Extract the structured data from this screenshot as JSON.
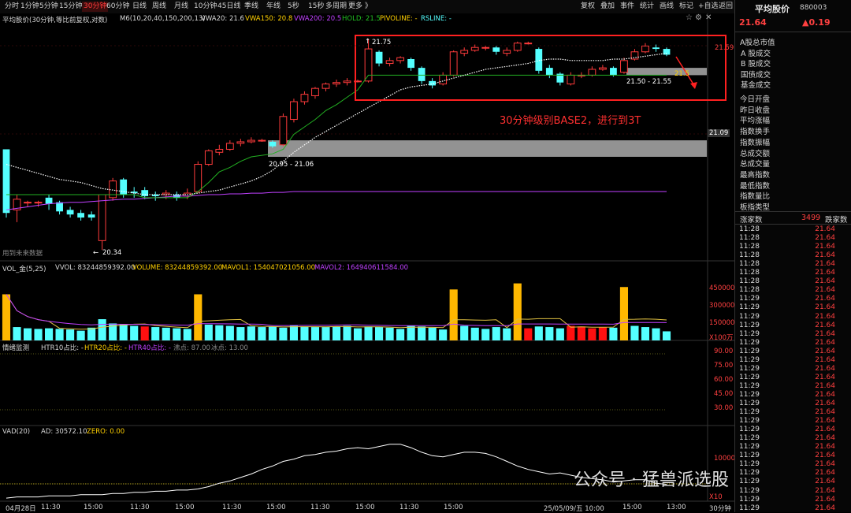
{
  "toolbar": {
    "timeframes": [
      "分时",
      "1分钟",
      "5分钟",
      "15分钟",
      "30分钟",
      "60分钟",
      "日线",
      "周线",
      "月线",
      "10分钟",
      "45日线",
      "季线",
      "年线",
      "5秒",
      "15秒",
      "多周期",
      "更多 》"
    ],
    "active_timeframe": "30分钟",
    "right": [
      "复权",
      "叠加",
      "事件",
      "统计",
      "画线",
      "标记",
      "+自选",
      "返回"
    ],
    "star_icon": "star-icon",
    "settings_icon": "gear-icon",
    "close_icon": "close-icon"
  },
  "chart_header": {
    "name": "平均股价(30分钟,等比前复权,对数)",
    "ma": "M6(10,20,40,150,200,13)",
    "vwa20": "VWA20: 21.6",
    "vwa150": "VWA150: 20.8",
    "vwa200": "VWA200: 20.5",
    "hold": "HOLD: 21.5",
    "pivoline": "PIVOLINE: -",
    "rsline": "RSLINE: -"
  },
  "annotations": {
    "high_label": "21.75",
    "low_label": "20.34",
    "zone1_label": "20.95 - 21.06",
    "zone2_label": "21.50 - 21.55",
    "hold_label": "21.5",
    "note": "30分钟级别BASE2，进行到3T",
    "future_data": "用到未来数据"
  },
  "price_axis": {
    "top": "21.59",
    "mid": "21.09"
  },
  "volume_header": {
    "name": "VOL_金(5,25)",
    "vvol": "VVOL: 83244859392.00",
    "volume": "VOLUME: 83244859392.00",
    "mavol1": "MAVOL1: 154047021056.00",
    "mavol2": "MAVOL2: 164940611584.00"
  },
  "volume_axis": [
    "450000",
    "300000",
    "150000",
    "X100万"
  ],
  "htr_header": {
    "name": "情绪监测",
    "htr10": "HTR10占比: -",
    "htr20": "HTR20占比: -",
    "htr40": "HTR40占比: -",
    "boil": "沸点: 87.00",
    "ice": "冰点: 13.00"
  },
  "htr_axis": [
    "90.00",
    "75.00",
    "60.00",
    "45.00",
    "30.00"
  ],
  "vad_header": {
    "name": "VAD(20)",
    "ad": "AD: 30572.10",
    "zero": "ZERO: 0.00"
  },
  "vad_axis": [
    "10000",
    "X10"
  ],
  "time_axis": [
    "04月28日",
    "11:30",
    "15:00",
    "11:30",
    "15:00",
    "11:30",
    "15:00",
    "11:30",
    "15:00",
    "11:30",
    "15:00",
    "25/05/09/五 10:00",
    "15:00",
    "13:00"
  ],
  "period_label": "30分钟",
  "watermark": "公众号 · 猛兽派选股",
  "side": {
    "title": "平均股价",
    "code": "880003",
    "price": "21.64",
    "change": "▲0.19",
    "sections": [
      "A股总市值",
      "A 股成交",
      "B 股成交",
      "国债成交",
      "基金成交",
      "今日开盘",
      "昨日收盘",
      "平均涨幅",
      "指数换手",
      "指数振幅",
      "总成交额",
      "总成交量",
      "最高指数",
      "最低指数",
      "指数量比",
      "板指类型"
    ],
    "rise_label": "涨家数",
    "rise_value": "3499",
    "fall_label": "跌家数",
    "ticks": [
      [
        "11:28",
        "21.64"
      ],
      [
        "11:28",
        "21.64"
      ],
      [
        "11:28",
        "21.64"
      ],
      [
        "11:28",
        "21.64"
      ],
      [
        "11:28",
        "21.64"
      ],
      [
        "11:28",
        "21.64"
      ],
      [
        "11:28",
        "21.64"
      ],
      [
        "11:28",
        "21.64"
      ],
      [
        "11:29",
        "21.64"
      ],
      [
        "11:29",
        "21.64"
      ],
      [
        "11:29",
        "21.64"
      ],
      [
        "11:29",
        "21.64"
      ],
      [
        "11:29",
        "21.64"
      ],
      [
        "11:29",
        "21.64"
      ],
      [
        "11:29",
        "21.64"
      ],
      [
        "11:29",
        "21.64"
      ],
      [
        "11:29",
        "21.64"
      ],
      [
        "11:29",
        "21.64"
      ],
      [
        "11:29",
        "21.64"
      ],
      [
        "11:29",
        "21.64"
      ],
      [
        "11:29",
        "21.64"
      ],
      [
        "11:29",
        "21.64"
      ],
      [
        "11:29",
        "21.64"
      ],
      [
        "11:29",
        "21.64"
      ],
      [
        "11:29",
        "21.64"
      ],
      [
        "11:29",
        "21.64"
      ],
      [
        "11:29",
        "21.64"
      ],
      [
        "11:29",
        "21.64"
      ],
      [
        "11:29",
        "21.64"
      ],
      [
        "11:29",
        "21.64"
      ],
      [
        "11:29",
        "21.64"
      ],
      [
        "11:29",
        "21.64"
      ],
      [
        "11:29",
        "21.64"
      ],
      [
        "11:29",
        "21.64"
      ],
      [
        "11:30",
        "21.64"
      ],
      [
        "11:30",
        "21.64"
      ]
    ]
  },
  "colors": {
    "up": "#ff3b3b",
    "down": "#54ffff",
    "vwa150": "#ffd000",
    "vwa200": "#c040ff",
    "hold": "#22b022",
    "pivot": "#ffffff",
    "box": "#ff2020",
    "zone": "#9a9a9a"
  },
  "chart_data": [
    {
      "type": "candlestick",
      "title": "平均股价(30分钟,等比前复权,对数)",
      "candles": [
        {
          "o": 21.0,
          "c": 20.58,
          "h": 21.0,
          "l": 20.55
        },
        {
          "o": 20.6,
          "c": 20.67,
          "h": 20.7,
          "l": 20.52
        },
        {
          "o": 20.65,
          "c": 20.65,
          "h": 20.66,
          "l": 20.62
        },
        {
          "o": 20.65,
          "c": 20.65,
          "h": 20.66,
          "l": 20.62
        },
        {
          "o": 20.68,
          "c": 20.64,
          "h": 20.7,
          "l": 20.6
        },
        {
          "o": 20.65,
          "c": 20.59,
          "h": 20.66,
          "l": 20.57
        },
        {
          "o": 20.6,
          "c": 20.57,
          "h": 20.62,
          "l": 20.55
        },
        {
          "o": 20.58,
          "c": 20.55,
          "h": 20.6,
          "l": 20.53
        },
        {
          "o": 20.57,
          "c": 20.55,
          "h": 20.59,
          "l": 20.53
        },
        {
          "o": 20.4,
          "c": 20.7,
          "h": 20.7,
          "l": 20.34
        },
        {
          "o": 20.68,
          "c": 20.79,
          "h": 20.81,
          "l": 20.66
        },
        {
          "o": 20.8,
          "c": 20.7,
          "h": 20.81,
          "l": 20.68
        },
        {
          "o": 20.72,
          "c": 20.71,
          "h": 20.75,
          "l": 20.68
        },
        {
          "o": 20.73,
          "c": 20.69,
          "h": 20.75,
          "l": 20.67
        },
        {
          "o": 20.7,
          "c": 20.69,
          "h": 20.72,
          "l": 20.66
        },
        {
          "o": 20.7,
          "c": 20.71,
          "h": 20.73,
          "l": 20.67
        },
        {
          "o": 20.7,
          "c": 20.68,
          "h": 20.72,
          "l": 20.66
        },
        {
          "o": 20.69,
          "c": 20.71,
          "h": 20.74,
          "l": 20.67
        },
        {
          "o": 20.72,
          "c": 20.9,
          "h": 20.92,
          "l": 20.71
        },
        {
          "o": 20.9,
          "c": 20.99,
          "h": 21.0,
          "l": 20.89
        },
        {
          "o": 20.98,
          "c": 21.0,
          "h": 21.03,
          "l": 20.96
        },
        {
          "o": 21.0,
          "c": 21.04,
          "h": 21.06,
          "l": 20.99
        },
        {
          "o": 21.04,
          "c": 21.05,
          "h": 21.07,
          "l": 21.02
        },
        {
          "o": 21.05,
          "c": 21.06,
          "h": 21.08,
          "l": 21.04
        },
        {
          "o": 21.06,
          "c": 21.06,
          "h": 21.07,
          "l": 21.05
        },
        {
          "o": 21.05,
          "c": 21.02,
          "h": 21.06,
          "l": 21.01
        },
        {
          "o": 21.03,
          "c": 21.22,
          "h": 21.24,
          "l": 21.02
        },
        {
          "o": 21.2,
          "c": 21.32,
          "h": 21.34,
          "l": 21.18
        },
        {
          "o": 21.32,
          "c": 21.37,
          "h": 21.39,
          "l": 21.3
        },
        {
          "o": 21.36,
          "c": 21.41,
          "h": 21.42,
          "l": 21.34
        },
        {
          "o": 21.41,
          "c": 21.44,
          "h": 21.45,
          "l": 21.39
        },
        {
          "o": 21.44,
          "c": 21.45,
          "h": 21.47,
          "l": 21.42
        },
        {
          "o": 21.45,
          "c": 21.46,
          "h": 21.48,
          "l": 21.43
        },
        {
          "o": 21.46,
          "c": 21.46,
          "h": 21.47,
          "l": 21.45
        },
        {
          "o": 21.46,
          "c": 21.68,
          "h": 21.75,
          "l": 21.45
        },
        {
          "o": 21.66,
          "c": 21.58,
          "h": 21.67,
          "l": 21.56
        },
        {
          "o": 21.58,
          "c": 21.6,
          "h": 21.62,
          "l": 21.56
        },
        {
          "o": 21.6,
          "c": 21.62,
          "h": 21.63,
          "l": 21.58
        },
        {
          "o": 21.61,
          "c": 21.55,
          "h": 21.62,
          "l": 21.53
        },
        {
          "o": 21.55,
          "c": 21.46,
          "h": 21.56,
          "l": 21.44
        },
        {
          "o": 21.46,
          "c": 21.43,
          "h": 21.48,
          "l": 21.41
        },
        {
          "o": 21.44,
          "c": 21.5,
          "h": 21.52,
          "l": 21.43
        },
        {
          "o": 21.5,
          "c": 21.66,
          "h": 21.67,
          "l": 21.49
        },
        {
          "o": 21.65,
          "c": 21.67,
          "h": 21.69,
          "l": 21.63
        },
        {
          "o": 21.67,
          "c": 21.69,
          "h": 21.71,
          "l": 21.66
        },
        {
          "o": 21.69,
          "c": 21.69,
          "h": 21.7,
          "l": 21.67
        },
        {
          "o": 21.69,
          "c": 21.66,
          "h": 21.7,
          "l": 21.64
        },
        {
          "o": 21.65,
          "c": 21.67,
          "h": 21.69,
          "l": 21.63
        },
        {
          "o": 21.67,
          "c": 21.72,
          "h": 21.73,
          "l": 21.66
        },
        {
          "o": 21.72,
          "c": 21.72,
          "h": 21.73,
          "l": 21.71
        },
        {
          "o": 21.68,
          "c": 21.53,
          "h": 21.69,
          "l": 21.51
        },
        {
          "o": 21.55,
          "c": 21.5,
          "h": 21.57,
          "l": 21.48
        },
        {
          "o": 21.51,
          "c": 21.45,
          "h": 21.52,
          "l": 21.43
        },
        {
          "o": 21.44,
          "c": 21.5,
          "h": 21.52,
          "l": 21.43
        },
        {
          "o": 21.5,
          "c": 21.5,
          "h": 21.52,
          "l": 21.48
        },
        {
          "o": 21.5,
          "c": 21.54,
          "h": 21.56,
          "l": 21.49
        },
        {
          "o": 21.54,
          "c": 21.55,
          "h": 21.57,
          "l": 21.53
        },
        {
          "o": 21.55,
          "c": 21.5,
          "h": 21.56,
          "l": 21.49
        },
        {
          "o": 21.52,
          "c": 21.6,
          "h": 21.62,
          "l": 21.51
        },
        {
          "o": 21.61,
          "c": 21.66,
          "h": 21.68,
          "l": 21.6
        },
        {
          "o": 21.66,
          "c": 21.7,
          "h": 21.72,
          "l": 21.65
        },
        {
          "o": 21.69,
          "c": 21.68,
          "h": 21.71,
          "l": 21.66
        },
        {
          "o": 21.68,
          "c": 21.64,
          "h": 21.69,
          "l": 21.63
        }
      ],
      "series": [
        {
          "name": "VWA150",
          "values": [
            20.6,
            20.61,
            20.62,
            20.63,
            20.64,
            20.645,
            20.65,
            20.65,
            20.655,
            20.66,
            20.665,
            20.67,
            20.67,
            20.675,
            20.68,
            20.685,
            20.69,
            20.69,
            20.695,
            20.7,
            20.7,
            20.705,
            20.705,
            20.71,
            20.71,
            20.715,
            20.715,
            20.72,
            20.72,
            20.72,
            20.72,
            20.72,
            20.72,
            20.72,
            20.72,
            20.72,
            20.72,
            20.72,
            20.72,
            20.72,
            20.72,
            20.72,
            20.72,
            20.72,
            20.72,
            20.72,
            20.72,
            20.72,
            20.72,
            20.72,
            20.72,
            20.72,
            20.72,
            20.72,
            20.72,
            20.72,
            20.72,
            20.72,
            20.72,
            20.72,
            20.72,
            20.72,
            20.72
          ]
        },
        {
          "name": "HOLD",
          "values": [
            20.7,
            20.7,
            20.7,
            20.7,
            20.7,
            20.7,
            20.7,
            20.7,
            20.7,
            20.7,
            20.7,
            20.7,
            20.7,
            20.68,
            20.68,
            20.68,
            20.68,
            20.68,
            20.72,
            20.78,
            20.85,
            20.88,
            20.92,
            20.95,
            20.96,
            20.97,
            21.0,
            21.1,
            21.15,
            21.2,
            21.26,
            21.3,
            21.35,
            21.4,
            21.5,
            21.5,
            21.5,
            21.5,
            21.5,
            21.5,
            21.5,
            21.5,
            21.5,
            21.5,
            21.5,
            21.5,
            21.5,
            21.5,
            21.5,
            21.5,
            21.5,
            21.5,
            21.5,
            21.5,
            21.5,
            21.5,
            21.5,
            21.5,
            21.5,
            21.5,
            21.5,
            21.5,
            21.5
          ]
        },
        {
          "name": "PIVOT",
          "values": [
            20.9,
            20.88,
            20.86,
            20.84,
            20.82,
            20.8,
            20.79,
            20.78,
            20.76,
            20.74,
            20.73,
            20.72,
            20.71,
            20.7,
            20.7,
            20.7,
            20.7,
            20.7,
            20.71,
            20.72,
            20.73,
            20.75,
            20.77,
            20.79,
            20.82,
            20.86,
            20.92,
            20.98,
            21.03,
            21.08,
            21.12,
            21.16,
            21.2,
            21.24,
            21.28,
            21.32,
            21.36,
            21.4,
            21.42,
            21.43,
            21.44,
            21.46,
            21.48,
            21.5,
            21.52,
            21.54,
            21.55,
            21.56,
            21.57,
            21.58,
            21.6,
            21.61,
            21.61,
            21.6,
            21.6,
            21.6,
            21.6,
            21.61,
            21.61,
            21.62,
            21.63,
            21.64,
            21.65
          ]
        }
      ],
      "zones": [
        {
          "low": 20.95,
          "high": 21.06
        },
        {
          "low": 21.5,
          "high": 21.55
        }
      ],
      "ylim": [
        20.3,
        21.8
      ]
    },
    {
      "type": "bar",
      "title": "VOL_金(5,25)",
      "values": [
        380,
        110,
        100,
        95,
        100,
        95,
        90,
        80,
        105,
        175,
        140,
        130,
        120,
        115,
        110,
        105,
        100,
        95,
        380,
        130,
        125,
        120,
        110,
        115,
        110,
        115,
        105,
        120,
        115,
        110,
        110,
        115,
        120,
        100,
        115,
        110,
        105,
        95,
        120,
        115,
        105,
        90,
        420,
        120,
        105,
        95,
        110,
        100,
        470,
        100,
        115,
        110,
        100,
        120,
        115,
        100,
        110,
        105,
        440,
        120,
        110,
        100,
        75
      ],
      "ylim": [
        0,
        500
      ]
    },
    {
      "type": "line",
      "title": "VAD(20)",
      "values": [
        0.2,
        0.3,
        0.3,
        0.3,
        0.4,
        0.4,
        0.4,
        0.5,
        0.5,
        0.5,
        0.6,
        0.6,
        0.7,
        0.7,
        0.8,
        0.8,
        0.9,
        0.9,
        1.0,
        1.2,
        1.5,
        1.7,
        2.0,
        2.3,
        2.7,
        3.0,
        3.4,
        3.6,
        3.9,
        4.0,
        4.2,
        4.3,
        4.5,
        4.6,
        4.5,
        4.7,
        4.9,
        4.9,
        4.6,
        4.2,
        3.9,
        3.8,
        4.0,
        4.2,
        4.2,
        4.1,
        3.8,
        3.4,
        3.0,
        2.7,
        2.5,
        2.3,
        2.4,
        2.2,
        2.0,
        1.9,
        1.8,
        1.6,
        1.7,
        1.8,
        1.8,
        1.5,
        1.4
      ],
      "ylim": [
        0,
        5.5
      ]
    }
  ]
}
